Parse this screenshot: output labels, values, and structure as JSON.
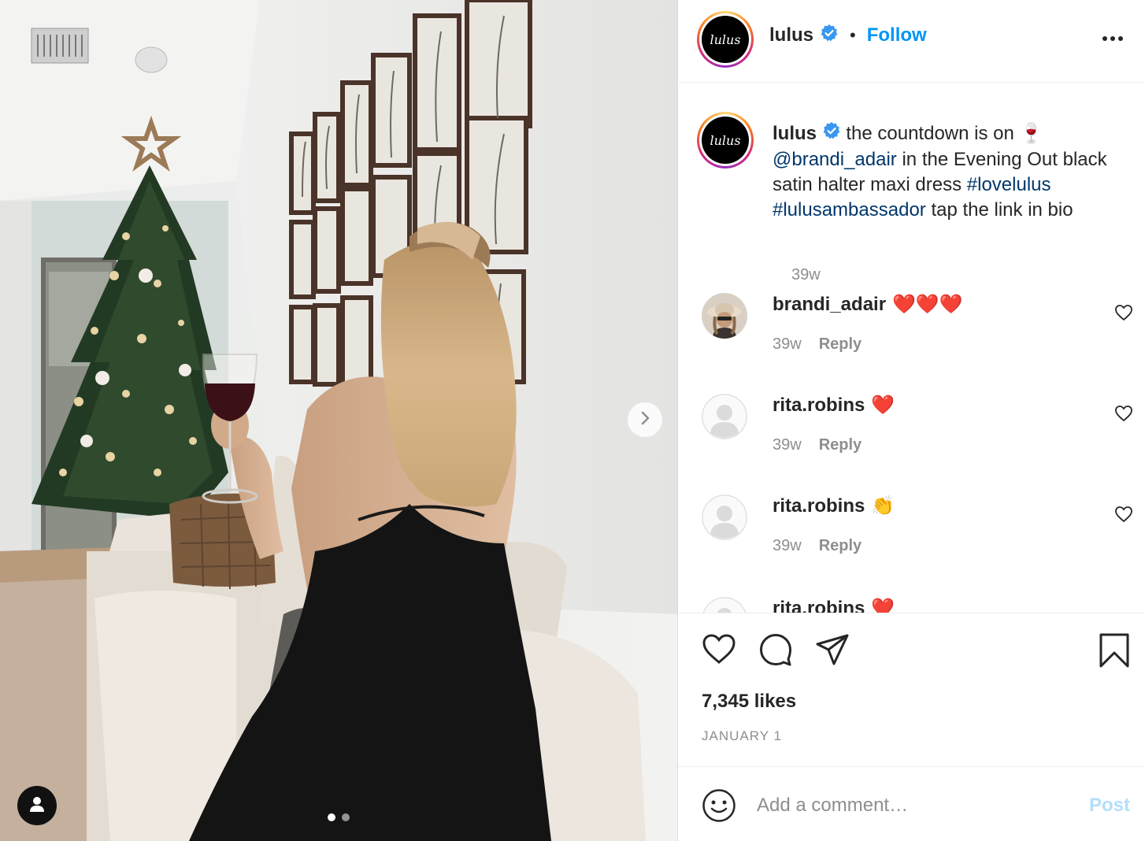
{
  "header": {
    "avatar_text": "lulus",
    "username": "lulus",
    "separator": "•",
    "follow_label": "Follow"
  },
  "caption": {
    "avatar_text": "lulus",
    "username": "lulus",
    "text_1": "the countdown is on 🍷",
    "mention": "@brandi_adair",
    "text_2": "in the Evening Out black satin halter maxi dress",
    "hashtag_1": "#lovelulus",
    "hashtag_2": "#lulusambassador",
    "text_3": "tap the link in bio",
    "time": "39w"
  },
  "comments": [
    {
      "username": "brandi_adair",
      "text": "❤️❤️❤️",
      "time": "39w",
      "reply_label": "Reply"
    },
    {
      "username": "rita.robins",
      "text": "❤️",
      "time": "39w",
      "reply_label": "Reply"
    },
    {
      "username": "rita.robins",
      "text": "👏",
      "time": "39w",
      "reply_label": "Reply"
    },
    {
      "username": "rita.robins",
      "text": "❤️"
    }
  ],
  "stats": {
    "likes": "7,345 likes",
    "date": "JANUARY 1"
  },
  "composer": {
    "placeholder": "Add a comment…",
    "post_label": "Post"
  },
  "carousel": {
    "current": 1,
    "total": 2
  },
  "colors": {
    "accent": "#0095f6",
    "link": "#00376b",
    "muted": "#8e8e8e",
    "verified": "#3897f0"
  },
  "icons": [
    "chevron-right-icon",
    "user-tag-icon",
    "verified-icon",
    "more-icon",
    "heart-icon",
    "comment-icon",
    "share-icon",
    "bookmark-icon",
    "emoji-icon"
  ]
}
